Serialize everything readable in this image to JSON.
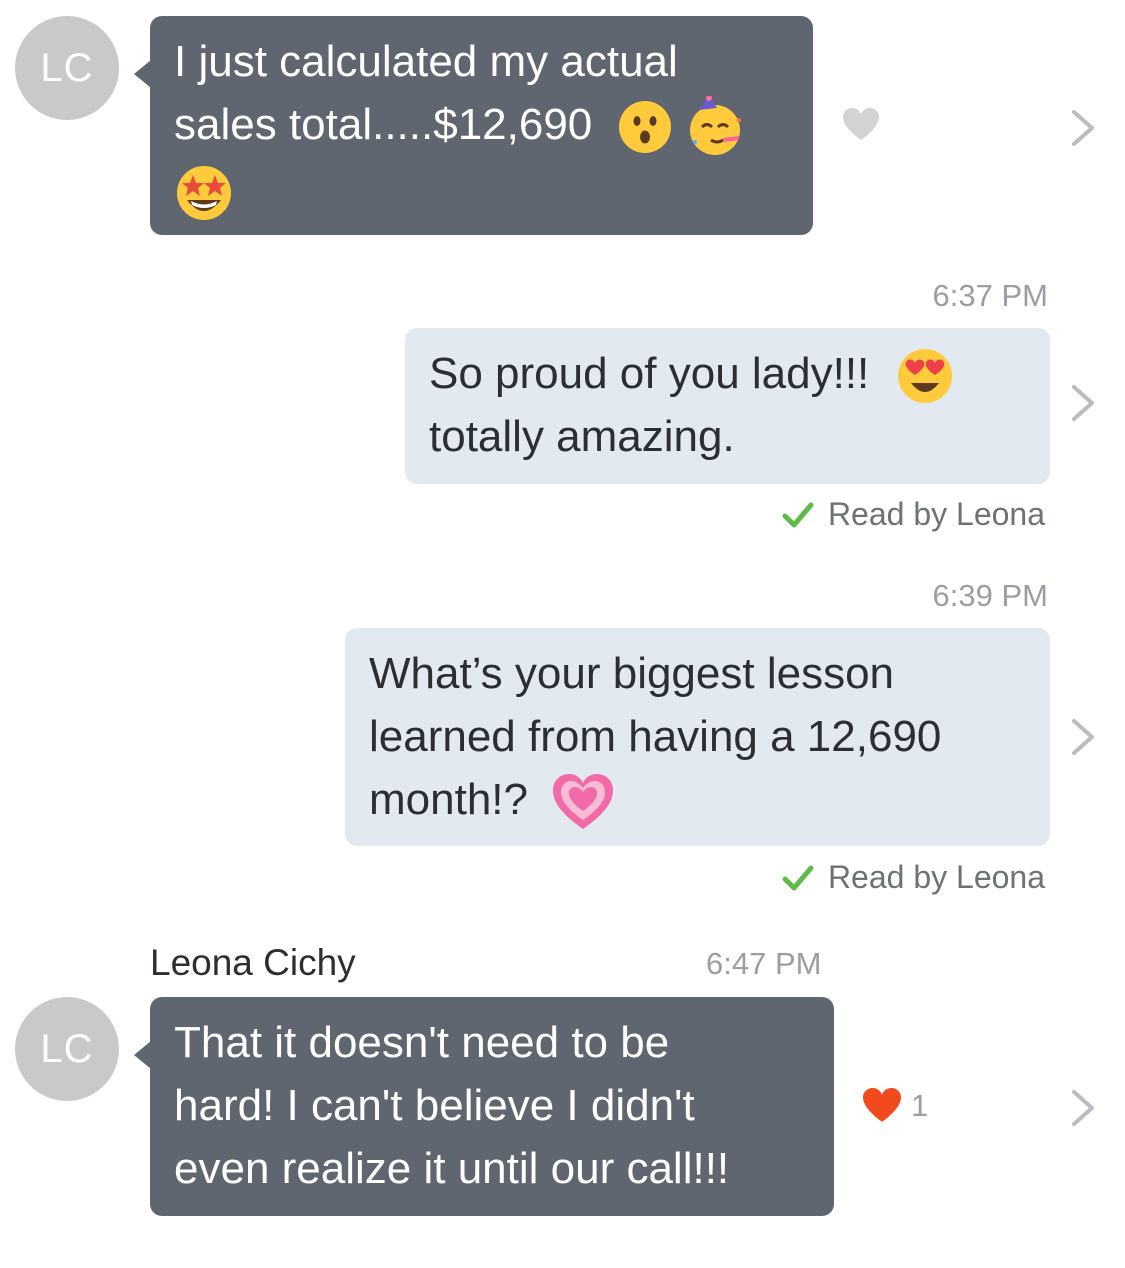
{
  "messages": [
    {
      "avatar_initials": "LC",
      "text_line1": "I just calculated my actual",
      "text_line2": "sales total.....$12,690",
      "reaction_count": ""
    },
    {
      "time": "6:37 PM",
      "text_line1": "So proud of you lady!!!",
      "text_line2": "totally amazing.",
      "receipt": "Read by Leona"
    },
    {
      "time": "6:39 PM",
      "text_line1": "What’s your biggest lesson",
      "text_line2": "learned from having a 12,690",
      "text_line3": "month!?",
      "receipt": "Read by Leona"
    },
    {
      "sender": "Leona Cichy",
      "time": "6:47 PM",
      "avatar_initials": "LC",
      "text_line1": "That it doesn't need to be",
      "text_line2": "hard! I can't believe I didn't",
      "text_line3": "even realize it until our call!!!",
      "reaction_count": "1"
    }
  ],
  "colors": {
    "incoming_bubble": "#5f6670",
    "outgoing_bubble": "#e3e9f1",
    "avatar": "#c9c9cb",
    "read_check": "#5dbb46",
    "heart_active": "#f24a1d",
    "heart_inactive": "#d3d3d5"
  },
  "icons": [
    "hushed-face-emoji",
    "party-face-emoji",
    "star-struck-emoji",
    "heart-eyes-emoji",
    "growing-heart-emoji",
    "heart-icon",
    "chevron-right-icon",
    "checkmark-icon"
  ]
}
